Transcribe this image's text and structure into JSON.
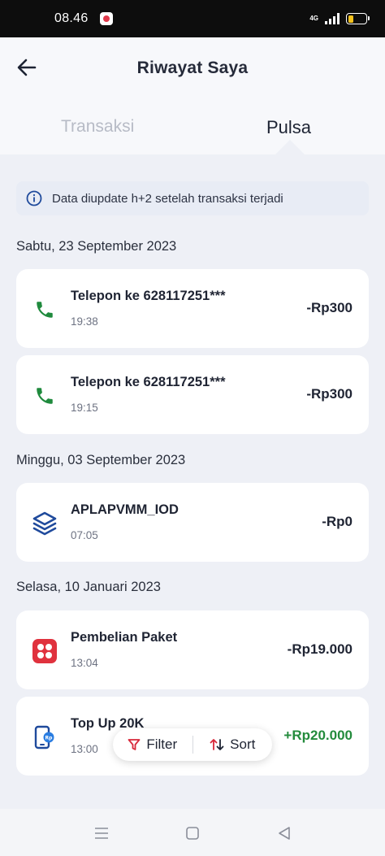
{
  "status_bar": {
    "time": "08.46",
    "network": "4G",
    "battery_color": "#f4c21c"
  },
  "header": {
    "title": "Riwayat Saya",
    "back_icon": "arrow-left-icon",
    "tabs": [
      {
        "label": "Transaksi",
        "active": false
      },
      {
        "label": "Pulsa",
        "active": true
      }
    ]
  },
  "info": {
    "icon": "info-icon",
    "text": "Data diupdate h+2 setelah transaksi terjadi"
  },
  "groups": [
    {
      "date": "Sabtu, 23 September 2023",
      "items": [
        {
          "icon": "phone-icon",
          "title": "Telepon ke 628117251***",
          "time": "19:38",
          "amount": "-Rp300"
        },
        {
          "icon": "phone-icon",
          "title": "Telepon ke 628117251***",
          "time": "19:15",
          "amount": "-Rp300"
        }
      ]
    },
    {
      "date": "Minggu, 03 September 2023",
      "items": [
        {
          "icon": "layers-icon",
          "title": "APLAPVMM_IOD",
          "time": "07:05",
          "amount": "-Rp0"
        }
      ]
    },
    {
      "date": "Selasa, 10 Januari 2023",
      "items": [
        {
          "icon": "package-icon",
          "title": "Pembelian Paket",
          "time": "13:04",
          "amount": "-Rp19.000"
        },
        {
          "icon": "topup-phone-icon",
          "title": "Top Up 20K",
          "time": "13:00",
          "amount": "+Rp20.000"
        }
      ]
    }
  ],
  "actions": {
    "filter_label": "Filter",
    "sort_label": "Sort"
  },
  "colors": {
    "phone_green": "#1f8a3d",
    "brand_red": "#e0323e",
    "layers_blue": "#1f4a9c",
    "positive_green": "#238b3c"
  }
}
